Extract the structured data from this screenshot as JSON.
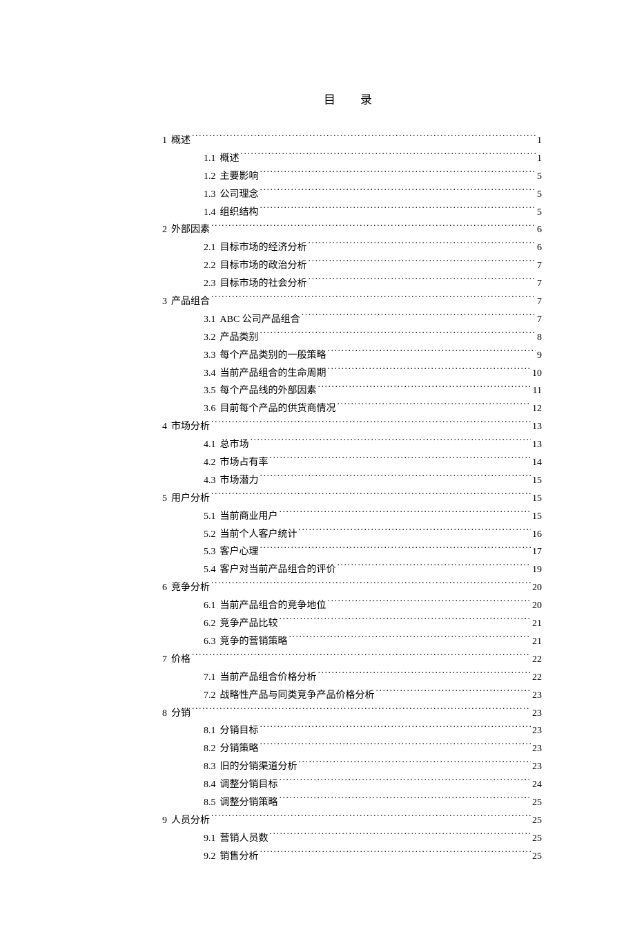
{
  "title": "目录",
  "toc": [
    {
      "level": 1,
      "num": "1",
      "text": "概述",
      "page": "1"
    },
    {
      "level": 2,
      "num": "1.1",
      "text": "概述",
      "page": "1"
    },
    {
      "level": 2,
      "num": "1.2",
      "text": "主要影响",
      "page": "5"
    },
    {
      "level": 2,
      "num": "1.3",
      "text": "公司理念",
      "page": "5"
    },
    {
      "level": 2,
      "num": "1.4",
      "text": "组织结构",
      "page": "5"
    },
    {
      "level": 1,
      "num": "2",
      "text": "外部因素",
      "page": "6"
    },
    {
      "level": 2,
      "num": "2.1",
      "text": "目标市场的经济分析",
      "page": "6"
    },
    {
      "level": 2,
      "num": "2.2",
      "text": "目标市场的政治分析",
      "page": "7"
    },
    {
      "level": 2,
      "num": "2.3",
      "text": "目标市场的社会分析",
      "page": "7"
    },
    {
      "level": 1,
      "num": "3",
      "text": "产品组合",
      "page": "7"
    },
    {
      "level": 2,
      "num": "3.1",
      "text": "ABC 公司产品组合 ",
      "page": "7"
    },
    {
      "level": 2,
      "num": "3.2",
      "text": "产品类别",
      "page": "8"
    },
    {
      "level": 2,
      "num": "3.3",
      "text": "每个产品类别的一般策略",
      "page": "9"
    },
    {
      "level": 2,
      "num": "3.4",
      "text": "当前产品组合的生命周期",
      "page": "10"
    },
    {
      "level": 2,
      "num": "3.5",
      "text": "每个产品线的外部因素",
      "page": "11"
    },
    {
      "level": 2,
      "num": "3.6",
      "text": "目前每个产品的供货商情况",
      "page": "12"
    },
    {
      "level": 1,
      "num": "4",
      "text": "市场分析",
      "page": "13"
    },
    {
      "level": 2,
      "num": "4.1",
      "text": "总市场",
      "page": "13"
    },
    {
      "level": 2,
      "num": "4.2",
      "text": "市场占有率",
      "page": "14"
    },
    {
      "level": 2,
      "num": "4.3",
      "text": "市场潜力",
      "page": "15"
    },
    {
      "level": 1,
      "num": "5",
      "text": "用户分析",
      "page": "15"
    },
    {
      "level": 2,
      "num": "5.1",
      "text": "当前商业用户",
      "page": "15"
    },
    {
      "level": 2,
      "num": "5.2",
      "text": "当前个人客户统计",
      "page": "16"
    },
    {
      "level": 2,
      "num": "5.3",
      "text": "客户心理",
      "page": "17"
    },
    {
      "level": 2,
      "num": "5.4",
      "text": "客户对当前产品组合的评价",
      "page": "19"
    },
    {
      "level": 1,
      "num": "6",
      "text": "竞争分析",
      "page": "20"
    },
    {
      "level": 2,
      "num": "6.1",
      "text": "当前产品组合的竞争地位",
      "page": "20"
    },
    {
      "level": 2,
      "num": "6.2",
      "text": "竞争产品比较",
      "page": "21"
    },
    {
      "level": 2,
      "num": "6.3",
      "text": "竞争的营销策略",
      "page": "21"
    },
    {
      "level": 1,
      "num": "7",
      "text": "价格",
      "page": "22"
    },
    {
      "level": 2,
      "num": "7.1",
      "text": "当前产品组合价格分析",
      "page": "22"
    },
    {
      "level": 2,
      "num": "7.2",
      "text": "战略性产品与同类竞争产品价格分析",
      "page": "23"
    },
    {
      "level": 1,
      "num": "8",
      "text": "分销",
      "page": "23"
    },
    {
      "level": 2,
      "num": "8.1",
      "text": "分销目标",
      "page": "23"
    },
    {
      "level": 2,
      "num": "8.2",
      "text": "分销策略",
      "page": "23"
    },
    {
      "level": 2,
      "num": "8.3",
      "text": "旧的分销渠道分析",
      "page": "23"
    },
    {
      "level": 2,
      "num": "8.4",
      "text": "调整分销目标",
      "page": "24"
    },
    {
      "level": 2,
      "num": "8.5",
      "text": "调整分销策略",
      "page": "25"
    },
    {
      "level": 1,
      "num": "9",
      "text": "人员分析",
      "page": "25"
    },
    {
      "level": 2,
      "num": "9.1",
      "text": "营销人员数",
      "page": "25"
    },
    {
      "level": 2,
      "num": "9.2",
      "text": "销售分析",
      "page": "25"
    }
  ]
}
